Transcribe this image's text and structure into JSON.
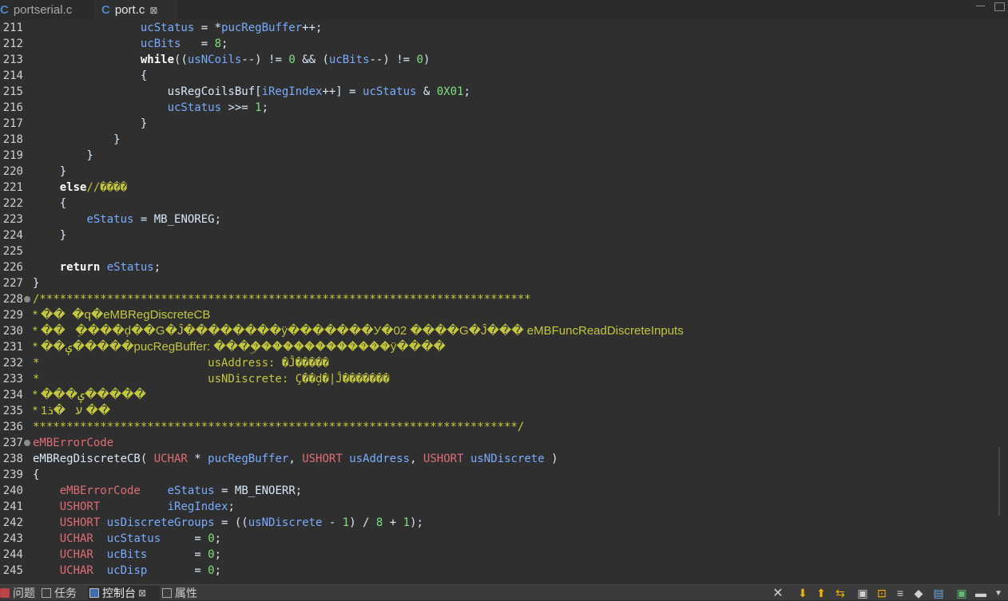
{
  "editor_tabs": [
    {
      "icon": "c-file-icon",
      "label": "portserial.c",
      "active": false
    },
    {
      "icon": "c-file-icon",
      "label": "port.c",
      "active": true,
      "close": "⊠"
    }
  ],
  "code": [
    {
      "n": "211",
      "text": "                ucStatus = *pucRegBuffer++;",
      "kind": "code"
    },
    {
      "n": "212",
      "text": "                ucBits   = 8;",
      "kind": "code"
    },
    {
      "n": "213",
      "text": "                while((usNCoils--) != 0 && (ucBits--) != 0)",
      "kind": "code"
    },
    {
      "n": "214",
      "text": "                {",
      "kind": "code"
    },
    {
      "n": "215",
      "text": "                    usRegCoilsBuf[iRegIndex++] = ucStatus & 0X01;",
      "kind": "code"
    },
    {
      "n": "216",
      "text": "                    ucStatus >>= 1;",
      "kind": "code"
    },
    {
      "n": "217",
      "text": "                }",
      "kind": "code"
    },
    {
      "n": "218",
      "text": "            }",
      "kind": "code"
    },
    {
      "n": "219",
      "text": "        }",
      "kind": "code"
    },
    {
      "n": "220",
      "text": "    }",
      "kind": "code"
    },
    {
      "n": "221",
      "text": "    else//����",
      "kind": "code"
    },
    {
      "n": "222",
      "text": "    {",
      "kind": "code"
    },
    {
      "n": "223",
      "text": "        eStatus = MB_ENOREG;",
      "kind": "code"
    },
    {
      "n": "224",
      "text": "    }",
      "kind": "code"
    },
    {
      "n": "225",
      "text": "",
      "kind": "code"
    },
    {
      "n": "226",
      "text": "    return eStatus;",
      "kind": "code"
    },
    {
      "n": "227",
      "text": "}",
      "kind": "code"
    },
    {
      "n": "228",
      "text": "/*************************************************************************",
      "kind": "comment",
      "fold": true
    },
    {
      "n": "229",
      "text": "* ��  �q�eMBRegDiscreteCB",
      "kind": "comment-sans"
    },
    {
      "n": "230",
      "text": "* ��   �ֵ���d̗��G�Ĵ��������ÿ�������У�02 ����G�Ĵ��� eMBFuncReadDiscreteInputs",
      "kind": "comment-sans"
    },
    {
      "n": "231",
      "text": "* ��ݷ�����pucRegBuffer: ���ۣ�������������ÿ����",
      "kind": "comment-sans"
    },
    {
      "n": "232",
      "text": "*                         usAddress: �Ĵ�����",
      "kind": "comment"
    },
    {
      "n": "233",
      "text": "*                         usNDiscrete: Ç��d̗�|Ĵ�������",
      "kind": "comment"
    },
    {
      "n": "234",
      "text": "* ���ݷ�����",
      "kind": "comment-sans"
    },
    {
      "n": "235",
      "text": "* ע   �ܪ1 ��",
      "kind": "comment-sans"
    },
    {
      "n": "236",
      "text": "************************************************************************/",
      "kind": "comment"
    },
    {
      "n": "237",
      "text": "eMBErrorCode",
      "kind": "code",
      "fold": true
    },
    {
      "n": "238",
      "text": "eMBRegDiscreteCB( UCHAR * pucRegBuffer, USHORT usAddress, USHORT usNDiscrete )",
      "kind": "code"
    },
    {
      "n": "239",
      "text": "{",
      "kind": "code"
    },
    {
      "n": "240",
      "text": "    eMBErrorCode    eStatus = MB_ENOERR;",
      "kind": "code"
    },
    {
      "n": "241",
      "text": "    USHORT          iRegIndex;",
      "kind": "code"
    },
    {
      "n": "242",
      "text": "    USHORT usDiscreteGroups = ((usNDiscrete - 1) / 8 + 1);",
      "kind": "code"
    },
    {
      "n": "243",
      "text": "    UCHAR  ucStatus     = 0;",
      "kind": "code"
    },
    {
      "n": "244",
      "text": "    UCHAR  ucBits       = 0;",
      "kind": "code"
    },
    {
      "n": "245",
      "text": "    UCHAR  ucDisp       = 0;",
      "kind": "code"
    }
  ],
  "panel_tabs": [
    {
      "icon": "problems-icon",
      "label": "问题"
    },
    {
      "icon": "tasks-icon",
      "label": "任务"
    },
    {
      "icon": "console-icon",
      "label": "控制台",
      "active": true,
      "close": "⊠"
    },
    {
      "icon": "properties-icon",
      "label": "属性"
    }
  ],
  "toolbar": [
    "close-console-icon",
    "scroll-lock-down-icon",
    "scroll-lock-up-icon",
    "swap-icon",
    "pin-icon",
    "lock-icon",
    "word-wrap-icon",
    "clear-icon",
    "display-selected-icon",
    "open-console-icon",
    "minimize-icon",
    "view-menu-icon"
  ],
  "colors": {
    "background": "#2f2f2f",
    "comment": "#c3c73a",
    "keyword": "#ffffff",
    "variable": "#79abff",
    "type": "#e06c75",
    "number": "#7fe07f",
    "plain": "#d9e8f7"
  }
}
